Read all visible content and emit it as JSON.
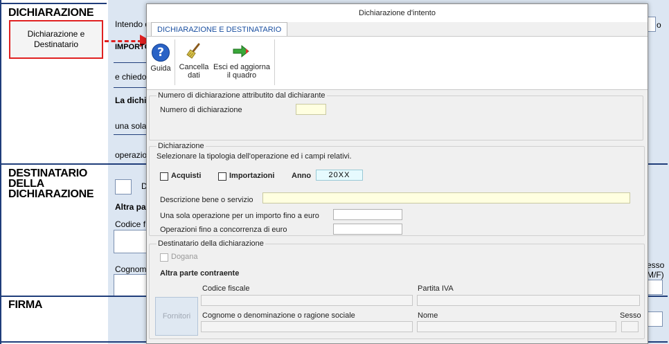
{
  "background": {
    "sections": {
      "dichiarazione": "DICHIARAZIONE",
      "destinatario": [
        "DESTINATARIO",
        "DELLA",
        "DICHIARAZIONE"
      ],
      "firma": "FIRMA"
    },
    "fragments": {
      "intendo": "Intendo d",
      "importo": "IMPORTO",
      "e_chiedo": "e chiedo",
      "la_dich": "La dichi",
      "una_sola": "una sola",
      "operazio": "operazio",
      "altra_pa": "Altra pa",
      "codice_f": "Codice f",
      "cognom": "Cognom",
      "d_letter": "D",
      "sesso": "esso",
      "mf": "M/F)",
      "o_letter": "o"
    },
    "dest_button_label": "Dichiarazione e Destinatario"
  },
  "dialog": {
    "title": "Dichiarazione d'intento",
    "tab": "DICHIARAZIONE E DESTINATARIO",
    "toolbar": {
      "guida": "Guida",
      "cancella": "Cancella dati",
      "esci": "Esci ed aggiorna il quadro"
    },
    "numero_group": {
      "title": "Numero di dichiarazione attributito dal dichiarante",
      "label": "Numero di dichiarazione",
      "value": ""
    },
    "dichiarazione_group": {
      "title": "Dichiarazione",
      "subtitle": "Selezionare la tipologia dell'operazione ed i campi relativi.",
      "acquisti_label": "Acquisti",
      "acquisti_checked": false,
      "importazioni_label": "Importazioni",
      "importazioni_checked": false,
      "anno_label": "Anno",
      "anno_value": "20XX",
      "descrizione_label": "Descrizione bene o servizio",
      "descrizione_value": "",
      "una_sola_label": "Una sola operazione per un importo fino a euro",
      "una_sola_value": "",
      "operazioni_label": "Operazioni fino a concorrenza di euro",
      "operazioni_value": ""
    },
    "destinatario_group": {
      "title": "Destinatario della dichiarazione",
      "dogana_label": "Dogana",
      "altra_parte_label": "Altra parte contraente",
      "fornitori_button": "Fornitori",
      "codice_fiscale_label": "Codice fiscale",
      "partita_iva_label": "Partita IVA",
      "cognome_label": "Cognome o denominazione o ragione sociale",
      "nome_label": "Nome",
      "sesso_label": "Sesso"
    }
  },
  "colors": {
    "accent_blue": "#1f3d7a",
    "tab_text": "#1a4fa0",
    "highlight_red": "#e02020",
    "background_panel": "#dce6f2"
  },
  "icons": {
    "guida": "help-icon",
    "cancella": "broom-icon",
    "esci": "exit-arrow-icon"
  }
}
